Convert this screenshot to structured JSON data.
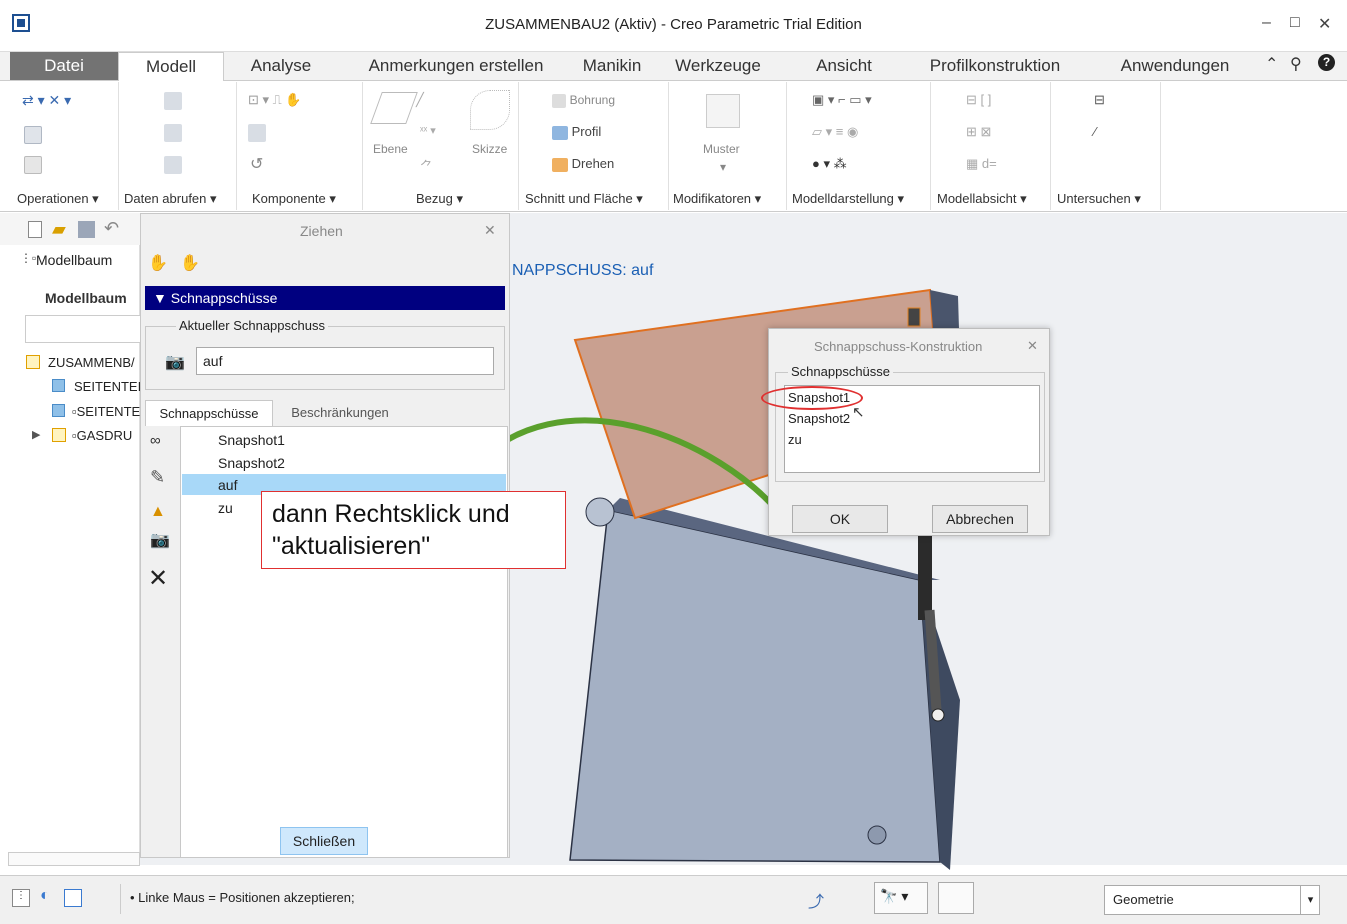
{
  "window": {
    "title": "ZUSAMMENBAU2 (Aktiv) - Creo Parametric Trial Edition",
    "min": "–",
    "max": "□",
    "close": "✕"
  },
  "tabs": {
    "datei": "Datei",
    "items": [
      "Modell",
      "Analyse",
      "Anmerkungen erstellen",
      "Manikin",
      "Werkzeuge",
      "Ansicht",
      "Profilkonstruktion",
      "Anwendungen"
    ]
  },
  "ribbon": {
    "groups": [
      "Operationen ▾",
      "Daten abrufen ▾",
      "Komponente ▾",
      "Bezug ▾",
      "Schnitt und Fläche ▾",
      "Modifikatoren ▾",
      "Modelldarstellung ▾",
      "Modellabsicht ▾",
      "Untersuchen ▾"
    ],
    "ebene": "Ebene",
    "skizze": "Skizze",
    "bohrung": "Bohrung",
    "profil": "Profil",
    "drehen": "Drehen",
    "muster": "Muster",
    "d_eq": "d="
  },
  "tree": {
    "tab": "Modellbaum",
    "header": "Modellbaum",
    "items": [
      "ZUSAMMENB/",
      "SEITENTEIL",
      "SEITENTE",
      "GASDRU"
    ]
  },
  "ziehen": {
    "title": "Ziehen",
    "close": "✕",
    "section": "Schnappschüsse",
    "current_label": "Aktueller Schnappschuss",
    "current_value": "auf",
    "subtabs": [
      "Schnappschüsse",
      "Beschränkungen"
    ],
    "list": [
      "Snapshot1",
      "Snapshot2",
      "auf",
      "zu"
    ],
    "selected": "auf",
    "close_button": "Schließen"
  },
  "viewport": {
    "snap_label": "NAPPSCHUSS: auf"
  },
  "dialog": {
    "title": "Schnappschuss-Konstruktion",
    "close": "✕",
    "group": "Schnappschüsse",
    "items": [
      "Snapshot1",
      "Snapshot2",
      "zu"
    ],
    "ok": "OK",
    "cancel": "Abbrechen"
  },
  "callout": {
    "line1": "dann Rechtsklick und",
    "line2": "\"aktualisieren\""
  },
  "status": {
    "message": "• Linke Maus = Positionen akzeptieren;",
    "filter": "Geometrie"
  },
  "colors": {
    "selection": "#000080",
    "highlight_row": "#a8d8f8",
    "arrow": "#5aa02c",
    "callout_border": "#e03030",
    "part_top": "#c9a090",
    "part_body": "#a4b0c4"
  }
}
